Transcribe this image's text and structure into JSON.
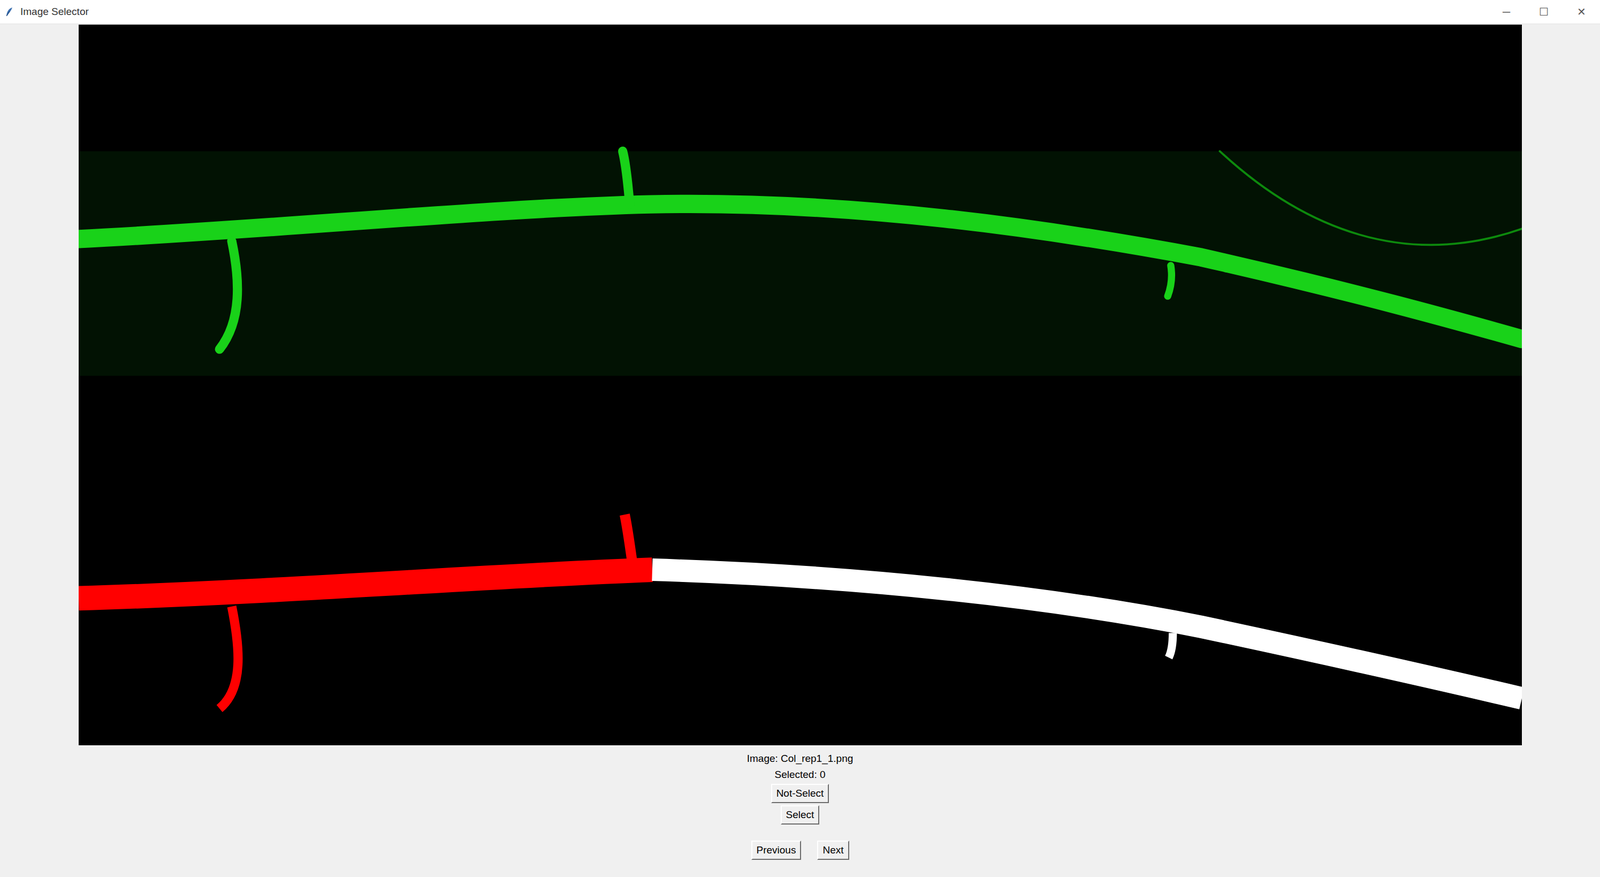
{
  "window": {
    "title": "Image Selector",
    "controls": [
      "─",
      "☐",
      "✕"
    ]
  },
  "image": {
    "label": "Image: Col_rep1_1.png"
  },
  "selection": {
    "label": "Selected: 0"
  },
  "buttons": {
    "not_select": "Not-Select",
    "select": "Select"
  },
  "navigation": [
    "Previous",
    "Next"
  ]
}
